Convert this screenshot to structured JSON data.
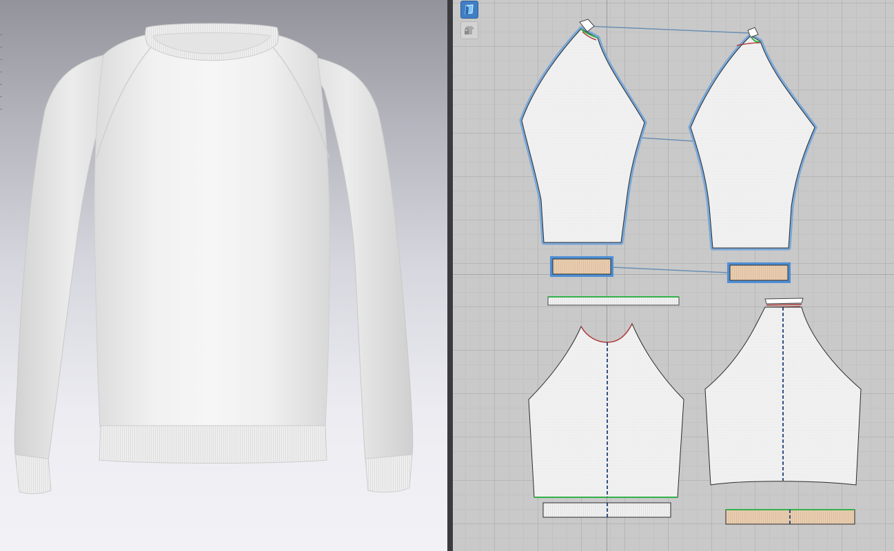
{
  "colors": {
    "accent_blue": "#3f7fc6",
    "selection_outline": "#7aa8d8",
    "rib_fill": "#e9cdb0",
    "fabric_fill": "#f0f0f0",
    "grid_bg": "#c9c9c9",
    "stitch_green": "#33b14a",
    "stitch_red": "#b03a3a"
  },
  "toolbar": {
    "tools": [
      {
        "name": "show-3d-garment-tool",
        "icon": "garment-view-icon",
        "active": true
      },
      {
        "name": "lock-garment-tool",
        "icon": "garment-lock-icon",
        "active": false
      }
    ]
  },
  "viewport3d": {
    "garment": "raglan-crew-sweatshirt",
    "color": "#f2f2f2"
  },
  "viewport2d": {
    "pieces": [
      {
        "name": "left-sleeve-pattern",
        "selected": true
      },
      {
        "name": "right-sleeve-pattern",
        "selected": true
      },
      {
        "name": "left-cuff-rib",
        "selected": true
      },
      {
        "name": "right-cuff-rib",
        "selected": true
      },
      {
        "name": "neck-rib",
        "selected": false
      },
      {
        "name": "front-body-pattern",
        "selected": false
      },
      {
        "name": "back-body-pattern",
        "selected": false
      },
      {
        "name": "hem-rib-front",
        "selected": false
      },
      {
        "name": "hem-rib-back",
        "selected": false
      }
    ]
  }
}
